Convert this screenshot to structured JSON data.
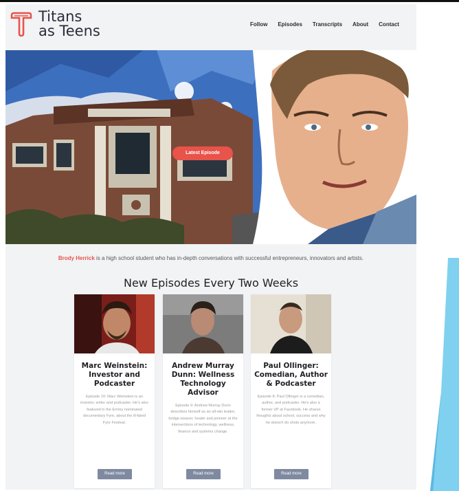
{
  "brand": {
    "line1": "Titans",
    "line2": "as Teens",
    "accent": "#e8534a"
  },
  "nav": [
    "Follow",
    "Episodes",
    "Transcripts",
    "About",
    "Contact"
  ],
  "hero": {
    "button_label": "Latest Episode"
  },
  "intro": {
    "name": "Brody Herrick",
    "text": " is a high school student who has in-depth conversations with successful entrepreneurs, innovators and artists."
  },
  "section_title": "New Episodes Every Two Weeks",
  "episodes": [
    {
      "title": "Marc Weinstein: Investor and Podcaster",
      "description": "Episode 10: Marc Weinstein is an investor, writer and podcaster. He's also featured in the Emmy nominated documentary Fyre, about the ill-fated Fyre Festival.",
      "button": "Read more"
    },
    {
      "title": "Andrew Murray Dunn: Wellness Technology Advisor",
      "description": "Episode 9: Andrew Murray Dunn describes himself as an all-win leader, bridge weaver, healer and pioneer at the intersections of technology, wellness, finance and systems change.",
      "button": "Read more"
    },
    {
      "title": "Paul Ollinger: Comedian, Author & Podcaster",
      "description": "Episode 8: Paul Ollinger is a comedian, author, and podcaster. He's also a former VP at Facebook. He shares thoughts about school, success and why he doesn't do shots anymore.",
      "button": "Read more"
    }
  ]
}
